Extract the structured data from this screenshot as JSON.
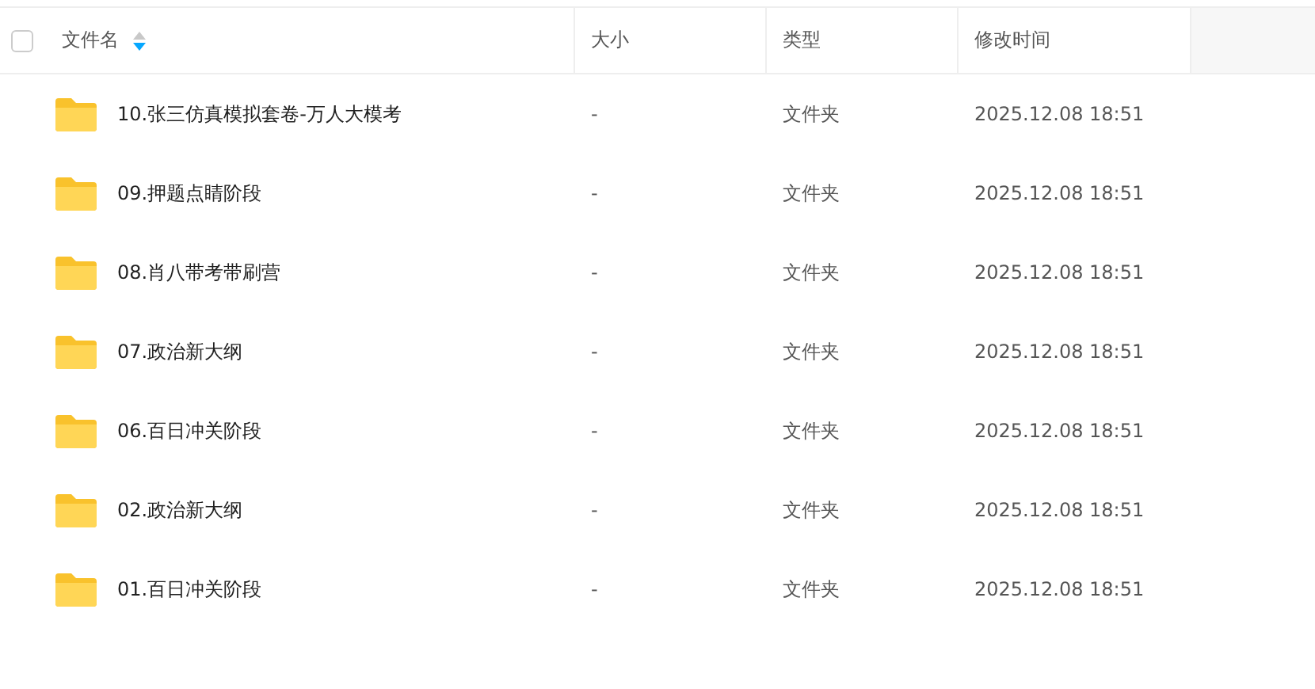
{
  "table": {
    "select_all": {
      "checked": false
    },
    "columns": [
      {
        "label": "文件名",
        "sorted": true,
        "descending": true
      },
      {
        "label": "大小",
        "sorted": false
      },
      {
        "label": "类型",
        "sorted": false
      },
      {
        "label": "修改时间",
        "sorted": false
      }
    ],
    "rows": [
      {
        "name": "10.张三仿真模拟套卷-万人大模考",
        "size": "-",
        "type": "文件夹",
        "modified": "2025.12.08 18:51"
      },
      {
        "name": "09.押题点睛阶段",
        "size": "-",
        "type": "文件夹",
        "modified": "2025.12.08 18:51"
      },
      {
        "name": "08.肖八带考带刷营",
        "size": "-",
        "type": "文件夹",
        "modified": "2025.12.08 18:51"
      },
      {
        "name": "07.政治新大纲",
        "size": "-",
        "type": "文件夹",
        "modified": "2025.12.08 18:51"
      },
      {
        "name": "06.百日冲关阶段",
        "size": "-",
        "type": "文件夹",
        "modified": "2025.12.08 18:51"
      },
      {
        "name": "02.政治新大纲",
        "size": "-",
        "type": "文件夹",
        "modified": "2025.12.08 18:51"
      },
      {
        "name": "01.百日冲关阶段",
        "size": "-",
        "type": "文件夹",
        "modified": "2025.12.08 18:51"
      }
    ]
  }
}
